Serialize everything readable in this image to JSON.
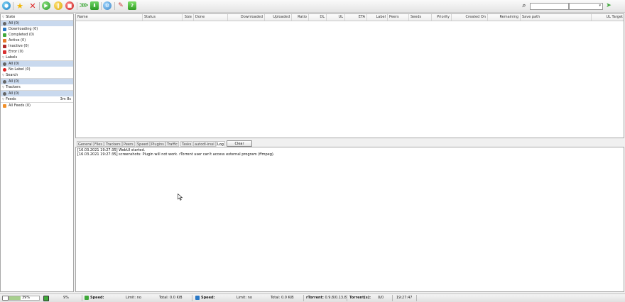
{
  "sidebar": {
    "state": {
      "title": "State",
      "items": [
        {
          "label": "All (0)"
        },
        {
          "label": "Downloading (0)"
        },
        {
          "label": "Completed (0)"
        },
        {
          "label": "Active (0)"
        },
        {
          "label": "Inactive (0)"
        },
        {
          "label": "Error (0)"
        }
      ]
    },
    "labels": {
      "title": "Labels",
      "items": [
        {
          "label": "All (0)"
        },
        {
          "label": "No Label (0)"
        }
      ]
    },
    "search": {
      "title": "Search",
      "items": [
        {
          "label": "All (0)"
        }
      ]
    },
    "trackers": {
      "title": "Trackers",
      "items": [
        {
          "label": "All (0)"
        }
      ]
    },
    "feeds": {
      "title": "Feeds",
      "refresh": "3m 8s",
      "items": [
        {
          "label": "All Feeds (0)"
        }
      ]
    }
  },
  "table": {
    "columns": [
      "Name",
      "Status",
      "Size",
      "Done",
      "Downloaded",
      "Uploaded",
      "Ratio",
      "DL",
      "UL",
      "ETA",
      "Label",
      "Peers",
      "Seeds",
      "Priority",
      "Created On",
      "Remaining",
      "Save path",
      "UL Target"
    ]
  },
  "tabs": {
    "items": [
      "General",
      "Files",
      "Trackers",
      "Peers",
      "Speed",
      "Plugins",
      "Traffic",
      "Tasks",
      "autodl-irssi",
      "Log"
    ],
    "active": "Log",
    "clear_label": "Clear"
  },
  "log": {
    "lines": [
      "[16.03.2021 19:27:35] WebUI started.",
      "[16.03.2021 19:27:35] screenshots: Plugin will not work. rTorrent user can't access external program (ffmpeg)."
    ]
  },
  "status": {
    "disk_percent": "39%",
    "cpu_percent": "9%",
    "dl_speed_label": "Speed:",
    "dl_limit": "Limit: no",
    "dl_total": "Total: 0.0 KiB",
    "ul_speed_label": "Speed:",
    "ul_limit": "Limit: no",
    "ul_total": "Total: 0.0 KiB",
    "rtorrent_label": "rTorrent:",
    "rtorrent_version": "0.9.8/0.13.8",
    "torrents_label": "Torrent(s):",
    "torrents_count": "0/0",
    "time": "19:27:47"
  },
  "colors": {
    "accent_green": "#3fa83a",
    "selected_row": "#c9d9ee"
  }
}
